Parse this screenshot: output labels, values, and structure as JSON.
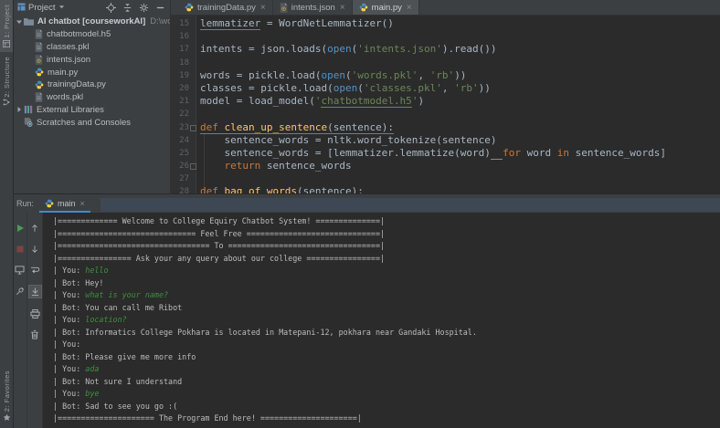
{
  "colors": {
    "panel_bg": "#3C3F41",
    "editor_bg": "#2B2B2B",
    "active_tab_bg": "#4E5254",
    "keyword": "#CC7832",
    "string": "#6A8759",
    "builtin": "#4E94CE",
    "function_name": "#FFC66B",
    "code_text": "#A9B7C6",
    "line_number": "#606366",
    "console_text": "#BCBCBC",
    "console_input_text": "#3F8F3F",
    "run_tab_underline": "#3592C4",
    "rerun_green": "#499C54",
    "stop_red": "#7D4343"
  },
  "activity_bar": {
    "top_items": [
      {
        "label": "1: Project",
        "active": true,
        "icon": "project-tool-icon"
      },
      {
        "label": "2: Structure",
        "active": false,
        "icon": "structure-tool-icon"
      }
    ],
    "bottom_items": [
      {
        "label": "2: Favorites",
        "active": false,
        "icon": "star-icon"
      }
    ]
  },
  "project_panel": {
    "title": "Project",
    "header_icons": [
      "locate-icon",
      "collapse-all-icon",
      "settings-gear-icon",
      "hide-icon"
    ],
    "root": {
      "label": "AI chatbot [courseworkAI]",
      "path": "D:\\work\\python\\",
      "icon": "folder-icon"
    },
    "files": [
      {
        "label": "chatbotmodel.h5",
        "icon": "file-icon"
      },
      {
        "label": "classes.pkl",
        "icon": "file-icon"
      },
      {
        "label": "intents.json",
        "icon": "json-file-icon"
      },
      {
        "label": "main.py",
        "icon": "python-file-icon"
      },
      {
        "label": "trainingData.py",
        "icon": "python-file-icon"
      },
      {
        "label": "words.pkl",
        "icon": "file-icon"
      }
    ],
    "other_nodes": [
      {
        "label": "External Libraries",
        "icon": "libraries-icon",
        "chevron": "chevron-right-icon"
      },
      {
        "label": "Scratches and Consoles",
        "icon": "scratches-icon",
        "chevron": null
      }
    ]
  },
  "editor": {
    "tabs": [
      {
        "label": "trainingData.py",
        "icon": "python-file-icon",
        "active": false
      },
      {
        "label": "intents.json",
        "icon": "json-file-icon",
        "active": false
      },
      {
        "label": "main.py",
        "icon": "python-file-icon",
        "active": true
      }
    ],
    "lines": [
      {
        "n": 15,
        "segs": [
          {
            "t": "lemmatizer",
            "c": "p",
            "u": true
          },
          {
            "t": " = WordNetLemmatizer()",
            "c": "p"
          }
        ]
      },
      {
        "n": 16,
        "segs": []
      },
      {
        "n": 17,
        "segs": [
          {
            "t": "intents = json.loads(",
            "c": "p"
          },
          {
            "t": "open",
            "c": "b"
          },
          {
            "t": "(",
            "c": "p"
          },
          {
            "t": "'intents.json'",
            "c": "s"
          },
          {
            "t": ").read())",
            "c": "p"
          }
        ]
      },
      {
        "n": 18,
        "segs": []
      },
      {
        "n": 19,
        "segs": [
          {
            "t": "words = pickle.load(",
            "c": "p"
          },
          {
            "t": "open",
            "c": "b"
          },
          {
            "t": "(",
            "c": "p"
          },
          {
            "t": "'words.pkl'",
            "c": "s"
          },
          {
            "t": ", ",
            "c": "p"
          },
          {
            "t": "'rb'",
            "c": "s"
          },
          {
            "t": "))",
            "c": "p"
          }
        ]
      },
      {
        "n": 20,
        "segs": [
          {
            "t": "classes = pickle.load(",
            "c": "p"
          },
          {
            "t": "open",
            "c": "b"
          },
          {
            "t": "(",
            "c": "p"
          },
          {
            "t": "'classes.pkl'",
            "c": "s"
          },
          {
            "t": ", ",
            "c": "p"
          },
          {
            "t": "'rb'",
            "c": "s"
          },
          {
            "t": "))",
            "c": "p"
          }
        ]
      },
      {
        "n": 21,
        "segs": [
          {
            "t": "model = load_model(",
            "c": "p"
          },
          {
            "t": "'",
            "c": "s"
          },
          {
            "t": "chatbotmodel.h5",
            "c": "sl"
          },
          {
            "t": "'",
            "c": "s"
          },
          {
            "t": ")",
            "c": "p"
          }
        ]
      },
      {
        "n": 22,
        "segs": []
      },
      {
        "n": 23,
        "fold": "start",
        "segs": [
          {
            "t": "def ",
            "c": "k",
            "u": true
          },
          {
            "t": "clean_up_sentence",
            "c": "f",
            "u": true
          },
          {
            "t": "(sentence):",
            "c": "p",
            "u": true
          }
        ]
      },
      {
        "n": 24,
        "segs": [
          {
            "t": "    sentence_words = nltk.word_tokenize(sentence)",
            "c": "p"
          }
        ]
      },
      {
        "n": 25,
        "segs": [
          {
            "t": "    sentence_words = [lemmatizer.lemmatize(word)",
            "c": "p"
          },
          {
            "t": "  ",
            "c": "w"
          },
          {
            "t": "for",
            "c": "k"
          },
          {
            "t": " word ",
            "c": "p"
          },
          {
            "t": "in",
            "c": "k"
          },
          {
            "t": " sentence_words]",
            "c": "p"
          }
        ]
      },
      {
        "n": 26,
        "fold": "end",
        "segs": [
          {
            "t": "    ",
            "c": "p"
          },
          {
            "t": "return",
            "c": "k"
          },
          {
            "t": " sentence_words",
            "c": "p"
          }
        ]
      },
      {
        "n": 27,
        "segs": []
      },
      {
        "n": 28,
        "segs": [
          {
            "t": "def ",
            "c": "k"
          },
          {
            "t": "bag_of_words",
            "c": "f"
          },
          {
            "t": "(sentence):",
            "c": "p"
          }
        ]
      }
    ]
  },
  "run_panel": {
    "label": "Run:",
    "tab": {
      "label": "main",
      "icon": "python-file-icon"
    },
    "left_toolbar": [
      "rerun-icon",
      "stop-icon",
      "console-icon",
      "pin-icon"
    ],
    "right_toolbar": [
      "up-arrow-icon",
      "down-arrow-icon",
      "soft-wrap-icon",
      "scroll-to-end-icon",
      "print-icon",
      "clear-icon"
    ],
    "selected_tool": "scroll-to-end-icon",
    "console_lines": [
      {
        "spans": [
          {
            "t": "|============= Welcome to College Equiry Chatbot System! ==============|",
            "c": "out"
          }
        ]
      },
      {
        "spans": [
          {
            "t": "|============================== Feel Free =============================|",
            "c": "out"
          }
        ]
      },
      {
        "spans": [
          {
            "t": "|================================= To =================================|",
            "c": "out"
          }
        ]
      },
      {
        "spans": [
          {
            "t": "|================ Ask your any query about our college ================|",
            "c": "out"
          }
        ]
      },
      {
        "spans": [
          {
            "t": "| You: ",
            "c": "out"
          },
          {
            "t": "hello",
            "c": "in"
          }
        ]
      },
      {
        "spans": [
          {
            "t": "| Bot: Hey!",
            "c": "out"
          }
        ]
      },
      {
        "spans": [
          {
            "t": "| You: ",
            "c": "out"
          },
          {
            "t": "what is your name?",
            "c": "in"
          }
        ]
      },
      {
        "spans": [
          {
            "t": "| Bot: You can call me Ribot",
            "c": "out"
          }
        ]
      },
      {
        "spans": [
          {
            "t": "| You: ",
            "c": "out"
          },
          {
            "t": "location?",
            "c": "in"
          }
        ]
      },
      {
        "spans": [
          {
            "t": "| Bot: Informatics College Pokhara is located in Matepani-12, pokhara near Gandaki Hospital.",
            "c": "out"
          }
        ]
      },
      {
        "spans": [
          {
            "t": "| You:",
            "c": "out"
          }
        ]
      },
      {
        "spans": [
          {
            "t": "| Bot: Please give me more info",
            "c": "out"
          }
        ]
      },
      {
        "spans": [
          {
            "t": "| You: ",
            "c": "out"
          },
          {
            "t": "ada",
            "c": "in"
          }
        ]
      },
      {
        "spans": [
          {
            "t": "| Bot: Not sure I understand",
            "c": "out"
          }
        ]
      },
      {
        "spans": [
          {
            "t": "| You: ",
            "c": "out"
          },
          {
            "t": "bye",
            "c": "in"
          }
        ]
      },
      {
        "spans": [
          {
            "t": "| Bot: Sad to see you go :(",
            "c": "out"
          }
        ]
      },
      {
        "spans": [
          {
            "t": "|===================== The Program End here! =====================|",
            "c": "out"
          }
        ]
      }
    ]
  }
}
